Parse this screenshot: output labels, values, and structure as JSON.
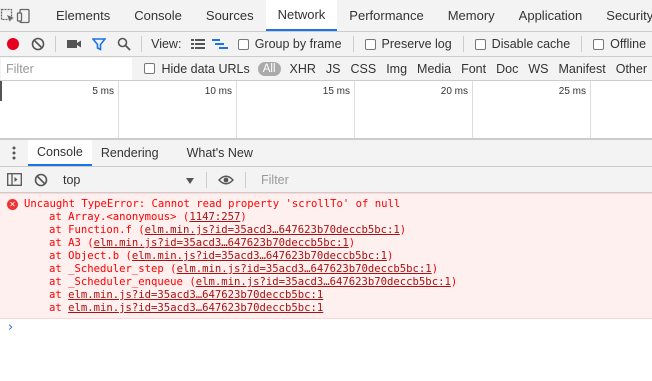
{
  "main_tabs": [
    "Elements",
    "Console",
    "Sources",
    "Network",
    "Performance",
    "Memory",
    "Application",
    "Security"
  ],
  "active_main_tab": "Network",
  "network_toolbar": {
    "view_label": "View:",
    "group_by_frame": "Group by frame",
    "preserve_log": "Preserve log",
    "disable_cache": "Disable cache",
    "offline": "Offline"
  },
  "filter_bar": {
    "placeholder": "Filter",
    "hide_data_urls": "Hide data URLs",
    "types": [
      "All",
      "XHR",
      "JS",
      "CSS",
      "Img",
      "Media",
      "Font",
      "Doc",
      "WS",
      "Manifest",
      "Other"
    ]
  },
  "overview": {
    "ticks": [
      "5 ms",
      "10 ms",
      "15 ms",
      "20 ms",
      "25 ms"
    ]
  },
  "drawer_tabs": [
    "Console",
    "Rendering",
    "What's New"
  ],
  "active_drawer_tab": "Console",
  "console_toolbar": {
    "context": "top",
    "filter_placeholder": "Filter"
  },
  "console": {
    "error_message": "Uncaught TypeError: Cannot read property 'scrollTo' of null",
    "stack": [
      {
        "prefix": "at Array.<anonymous> (",
        "link": "1147:257",
        "suffix": ")"
      },
      {
        "prefix": "at Function.f (",
        "link": "elm.min.js?id=35acd3…647623b70deccb5bc:1",
        "suffix": ")"
      },
      {
        "prefix": "at A3 (",
        "link": "elm.min.js?id=35acd3…647623b70deccb5bc:1",
        "suffix": ")"
      },
      {
        "prefix": "at Object.b (",
        "link": "elm.min.js?id=35acd3…647623b70deccb5bc:1",
        "suffix": ")"
      },
      {
        "prefix": "at _Scheduler_step (",
        "link": "elm.min.js?id=35acd3…647623b70deccb5bc:1",
        "suffix": ")"
      },
      {
        "prefix": "at _Scheduler_enqueue (",
        "link": "elm.min.js?id=35acd3…647623b70deccb5bc:1",
        "suffix": ")"
      },
      {
        "prefix": "at ",
        "link": "elm.min.js?id=35acd3…647623b70deccb5bc:1",
        "suffix": ""
      },
      {
        "prefix": "at ",
        "link": "elm.min.js?id=35acd3…647623b70deccb5bc:1",
        "suffix": ""
      }
    ],
    "prompt_symbol": "›"
  },
  "colors": {
    "accent": "#1a73e8",
    "record": "#e8001f",
    "error_text": "#ff0000",
    "error_bg": "#fff0f0"
  }
}
